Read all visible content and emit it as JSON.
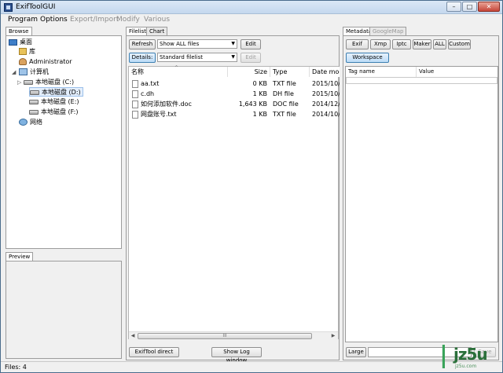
{
  "window": {
    "title": "ExifToolGUI",
    "minimize": "–",
    "maximize": "□",
    "close": "✕"
  },
  "menu": [
    {
      "label": "Program",
      "enabled": true
    },
    {
      "label": "Options",
      "enabled": true
    },
    {
      "label": "Export/Import",
      "enabled": false
    },
    {
      "label": "Modify",
      "enabled": false
    },
    {
      "label": "Various",
      "enabled": false
    }
  ],
  "left": {
    "browse_tab": "Browse",
    "tree": [
      {
        "label": "桌面",
        "icon": "desktop-icon",
        "level": 0
      },
      {
        "label": "库",
        "icon": "library-icon",
        "level": 1
      },
      {
        "label": "Administrator",
        "icon": "user-folder-icon",
        "level": 1
      },
      {
        "label": "计算机",
        "icon": "computer-icon",
        "level": 1
      },
      {
        "label": "本地磁盘 (C:)",
        "icon": "drive-icon",
        "level": 2
      },
      {
        "label": "本地磁盘 (D:)",
        "icon": "drive-icon",
        "level": 2,
        "selected": true
      },
      {
        "label": "本地磁盘 (E:)",
        "icon": "drive-icon",
        "level": 2
      },
      {
        "label": "本地磁盘 (F:)",
        "icon": "drive-icon",
        "level": 2
      },
      {
        "label": "网络",
        "icon": "network-icon",
        "level": 1
      }
    ],
    "preview_tab": "Preview"
  },
  "middle": {
    "tabs": [
      "Filelist",
      "Chart"
    ],
    "refresh_label": "Refresh",
    "show_filter": "Show ALL files",
    "edit_label": "Edit",
    "details_label": "Details:",
    "filelist_mode": "Standard filelist",
    "edit2_label": "Edit",
    "columns": [
      "名称",
      "Size",
      "Type",
      "Date moc"
    ],
    "files": [
      {
        "name": "aa.txt",
        "size": "0 KB",
        "type": "TXT file",
        "date": "2015/10/."
      },
      {
        "name": "c.dh",
        "size": "1 KB",
        "type": "DH file",
        "date": "2015/10/."
      },
      {
        "name": "如何添加软件.doc",
        "size": "1,643 KB",
        "type": "DOC file",
        "date": "2014/12/."
      },
      {
        "name": "网盘账号.txt",
        "size": "1 KB",
        "type": "TXT file",
        "date": "2014/10/."
      }
    ],
    "scroll_grip": "III",
    "exiftool_direct": "ExifTool direct",
    "show_log": "Show Log window"
  },
  "right": {
    "tabs": [
      "Metadata",
      "GoogleMap"
    ],
    "buttons": [
      "Exif",
      "Xmp",
      "Iptc",
      "Maker",
      "ALL",
      "Custom"
    ],
    "workspace_label": "Workspace",
    "columns": [
      "Tag name",
      "Value"
    ],
    "large_label": "Large",
    "save_label": "Save"
  },
  "status": {
    "text": "Files: 4"
  },
  "watermark": {
    "brand": "jz5u",
    "sub": "jz5u.com"
  }
}
